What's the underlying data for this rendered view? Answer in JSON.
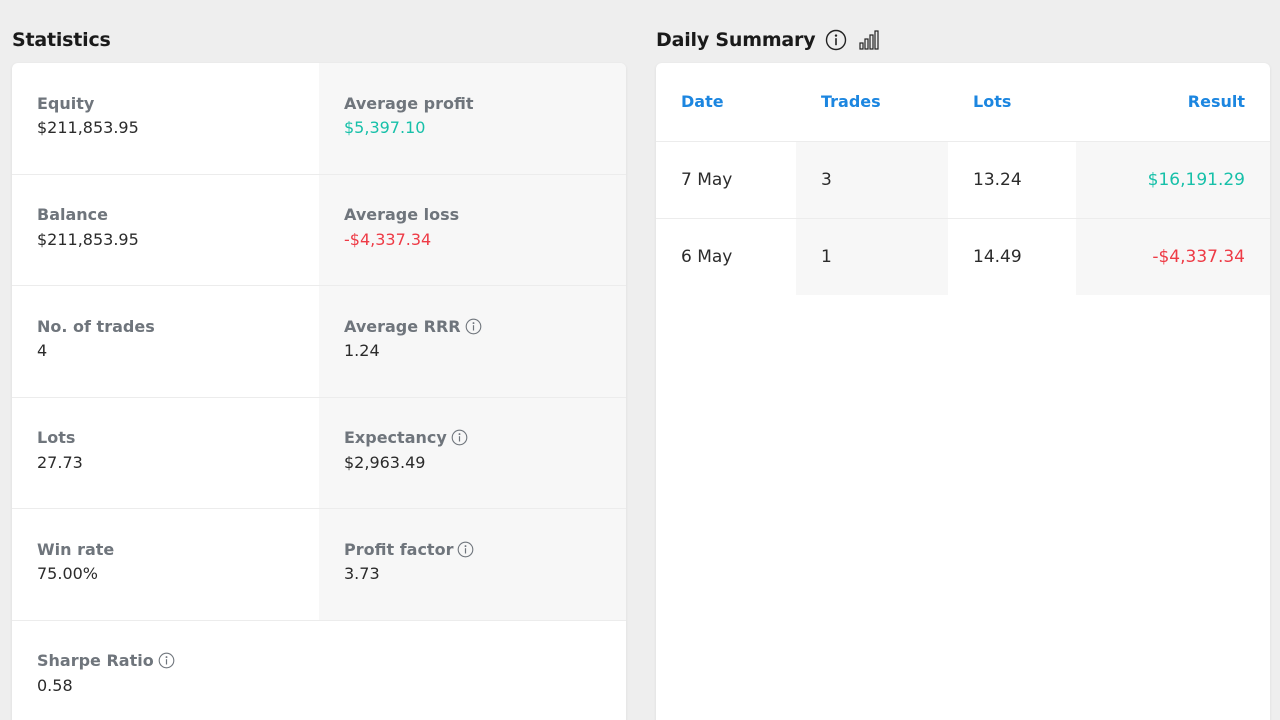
{
  "statistics": {
    "title": "Statistics",
    "items": [
      {
        "label": "Equity",
        "value": "$211,853.95",
        "tone": "neutral",
        "info": false
      },
      {
        "label": "Average profit",
        "value": "$5,397.10",
        "tone": "positive",
        "info": false
      },
      {
        "label": "Balance",
        "value": "$211,853.95",
        "tone": "neutral",
        "info": false
      },
      {
        "label": "Average loss",
        "value": "-$4,337.34",
        "tone": "negative",
        "info": false
      },
      {
        "label": "No. of trades",
        "value": "4",
        "tone": "neutral",
        "info": false
      },
      {
        "label": "Average RRR",
        "value": "1.24",
        "tone": "neutral",
        "info": true
      },
      {
        "label": "Lots",
        "value": "27.73",
        "tone": "neutral",
        "info": false
      },
      {
        "label": "Expectancy",
        "value": "$2,963.49",
        "tone": "neutral",
        "info": true
      },
      {
        "label": "Win rate",
        "value": "75.00%",
        "tone": "neutral",
        "info": false
      },
      {
        "label": "Profit factor",
        "value": "3.73",
        "tone": "neutral",
        "info": true
      },
      {
        "label": "Sharpe Ratio",
        "value": "0.58",
        "tone": "neutral",
        "info": true
      }
    ]
  },
  "daily_summary": {
    "title": "Daily Summary",
    "icons": [
      "info-icon",
      "bar-chart-icon"
    ],
    "columns": [
      "Date",
      "Trades",
      "Lots",
      "Result"
    ],
    "rows": [
      {
        "date": "7 May",
        "trades": "3",
        "lots": "13.24",
        "result": "$16,191.29",
        "tone": "positive"
      },
      {
        "date": "6 May",
        "trades": "1",
        "lots": "14.49",
        "result": "-$4,337.34",
        "tone": "negative"
      }
    ]
  },
  "colors": {
    "accent_blue": "#1c86e0",
    "positive": "#17c0a9",
    "negative": "#ee3b46",
    "label_gray": "#6f757c"
  }
}
